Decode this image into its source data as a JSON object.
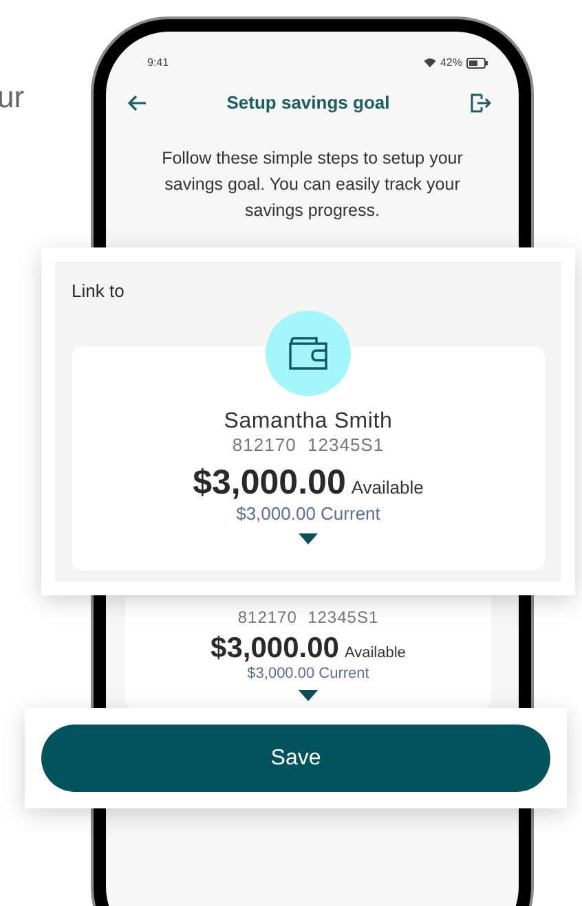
{
  "side_text": "ur",
  "status_bar": {
    "time": "9:41",
    "battery": "42%"
  },
  "header": {
    "title": "Setup savings goal"
  },
  "intro": "Follow these simple steps to setup your savings goal. You can easily track your savings progress.",
  "account_behind": {
    "number": "812170  12345S1",
    "amount": "$3,000.00",
    "amount_label": "Available",
    "current": "$3,000.00 Current"
  },
  "link_callout": {
    "label": "Link to",
    "name": "Samantha Smith",
    "number": "812170  12345S1",
    "amount": "$3,000.00",
    "amount_label": "Available",
    "current": "$3,000.00 Current"
  },
  "save_button": {
    "label": "Save"
  }
}
